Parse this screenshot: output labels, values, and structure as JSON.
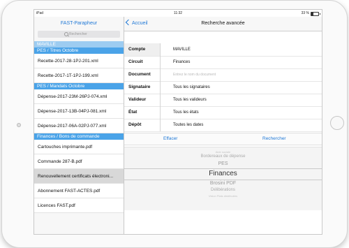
{
  "status_bar": {
    "carrier": "iPad",
    "time": "11:32",
    "battery": "33 %",
    "battery_level": 0.33
  },
  "master": {
    "title": "FAST-Parapheur",
    "search_placeholder": "Rechercher",
    "sections": [
      {
        "header": "MAVILLE",
        "items": []
      },
      {
        "header": "PES / Titres Octobre",
        "items": [
          "Recette-2017-28-1PJ-201.xml",
          "Recette-2017-1T-1PJ-199.xml"
        ]
      },
      {
        "header": "PES / Mandats Octobre",
        "items": [
          "Dépense-2017-23M-26PJ-074.xml",
          "Dépense-2017-13B-04PJ-081.xml",
          "Dépense-2017-06A-02PJ-077.xml"
        ]
      },
      {
        "header": "Finances / Bons de commande",
        "items": [
          "Cartouches imprimante.pdf",
          "Commande 287-B.pdf",
          "Renouvellement certificats électroni...",
          "Abonnement FAST-ACTES.pdf",
          "Licences FAST.pdf"
        ]
      }
    ]
  },
  "detail": {
    "back_label": "Accueil",
    "title": "Recherche avancée",
    "fields": [
      {
        "label": "Compte",
        "value": "MAVILLE"
      },
      {
        "label": "Circuit",
        "value": "Finances"
      },
      {
        "label": "Document",
        "value": "Entrez le nom du document"
      },
      {
        "label": "Signataire",
        "value": "Tous les signataires"
      },
      {
        "label": "Valideur",
        "value": "Tous les valideurs"
      },
      {
        "label": "État",
        "value": "Tous les états"
      },
      {
        "label": "Dépôt",
        "value": "Toutes les dates"
      }
    ],
    "clear_label": "Effacer",
    "search_label": "Rechercher",
    "picker_options": [
      "Aide sociale",
      "Bordereaux de dépense",
      "PES",
      "Finances",
      "Brosini PDF",
      "Délibérations",
      "Vision Plats distribuées"
    ],
    "picker_selected": "Finances"
  }
}
